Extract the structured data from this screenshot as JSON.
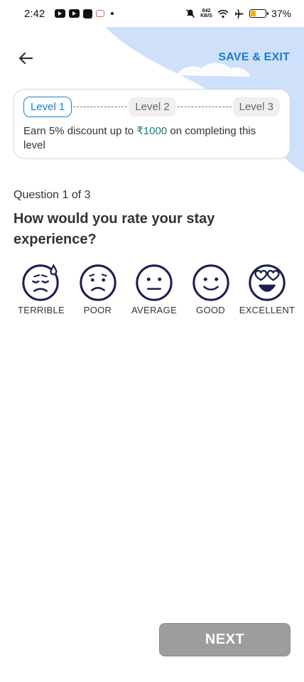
{
  "status_bar": {
    "time": "2:42",
    "net_speed_top": "642",
    "net_speed_bottom": "KB/S",
    "battery_percent": "37%",
    "battery_level": 0.37,
    "icons": [
      "youtube-icon",
      "youtube-icon",
      "app-icon",
      "app-icon",
      "dot",
      "mute-icon",
      "wifi-icon",
      "airplane-icon",
      "battery-icon"
    ]
  },
  "header": {
    "back_icon": "arrow-left-icon",
    "save_exit_label": "SAVE & EXIT"
  },
  "levels": {
    "items": [
      {
        "label": "Level 1",
        "active": true
      },
      {
        "label": "Level 2",
        "active": false
      },
      {
        "label": "Level 3",
        "active": false
      }
    ],
    "description_prefix": "Earn 5% discount up to ",
    "description_amount": "₹1000",
    "description_suffix": " on completing this level"
  },
  "question": {
    "count": "Question 1 of 3",
    "text": "How would you rate your stay experience?"
  },
  "ratings": [
    {
      "label": "TERRIBLE",
      "icon": "face-terrible-icon"
    },
    {
      "label": "POOR",
      "icon": "face-poor-icon"
    },
    {
      "label": "AVERAGE",
      "icon": "face-average-icon"
    },
    {
      "label": "GOOD",
      "icon": "face-good-icon"
    },
    {
      "label": "EXCELLENT",
      "icon": "face-excellent-icon"
    }
  ],
  "footer": {
    "next_label": "NEXT"
  },
  "colors": {
    "accent": "#1a7ec8",
    "amount": "#0f8077",
    "face_stroke": "#1b1f4e",
    "cloud": "#cfe0fb",
    "next_disabled": "#9d9d9d"
  }
}
